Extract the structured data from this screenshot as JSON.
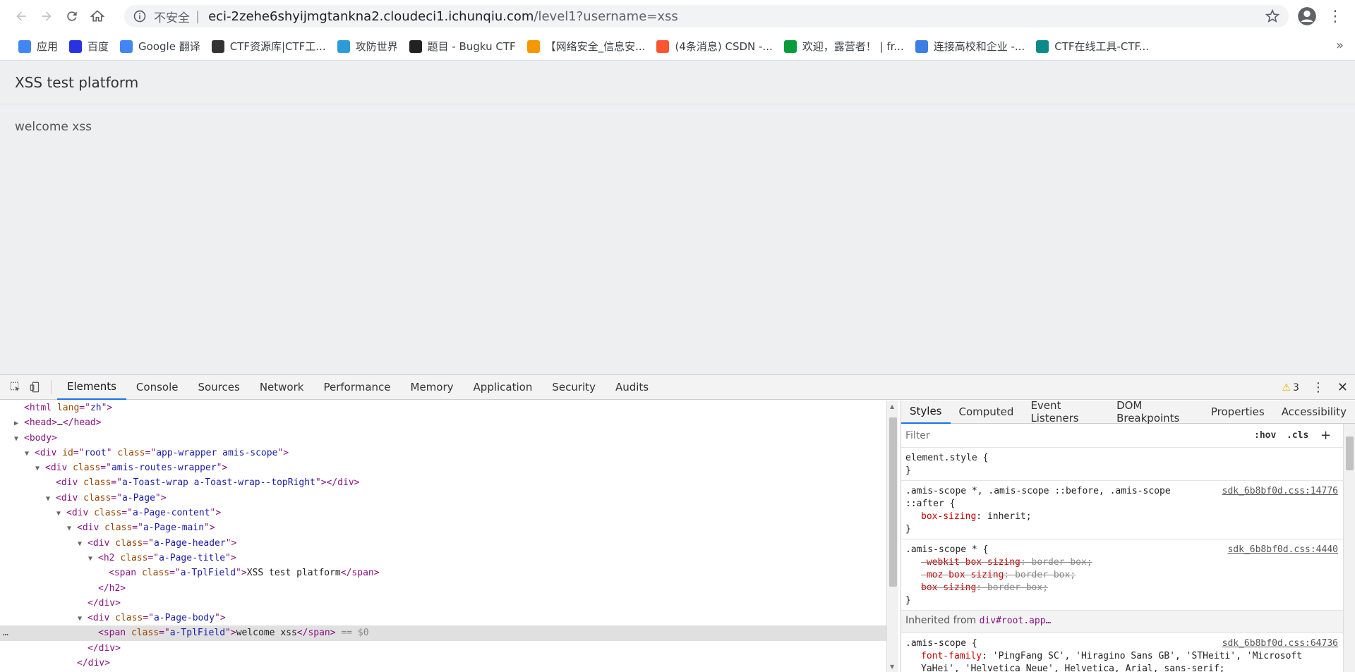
{
  "browser": {
    "security_label": "不安全",
    "separator": "|",
    "url_host": "eci-2zehe6shyijmgtankna2.cloudeci1.ichunqiu.com",
    "url_path": "/level1?username=xss",
    "more_bookmarks": "»",
    "bookmarks": [
      {
        "label": "应用",
        "icon": "apps-grid-icon",
        "color": "#4285f4"
      },
      {
        "label": "百度",
        "icon": "baidu-paw-icon",
        "color": "#2932e1"
      },
      {
        "label": "Google 翻译",
        "icon": "google-translate-icon",
        "color": "#4285f4"
      },
      {
        "label": "CTF资源库|CTF工...",
        "icon": "ctf-hacker-icon",
        "color": "#333333"
      },
      {
        "label": "攻防世界",
        "icon": "swirl-icon",
        "color": "#2e9bd8"
      },
      {
        "label": "题目 - Bugku CTF",
        "icon": "flag-icon",
        "color": "#222222"
      },
      {
        "label": "【网络安全_信息安...",
        "icon": "hexagon-icon",
        "color": "#f39800"
      },
      {
        "label": "(4条消息) CSDN -...",
        "icon": "csdn-c-icon",
        "color": "#fc5531"
      },
      {
        "label": "欢迎，露营者！ | fr...",
        "icon": "freecodecamp-icon",
        "color": "#0a9b3c"
      },
      {
        "label": "连接高校和企业 -...",
        "icon": "cloud-link-icon",
        "color": "#3d7ee5"
      },
      {
        "label": "CTF在线工具-CTF...",
        "icon": "ctf-tools-icon",
        "color": "#0b8a8a"
      }
    ]
  },
  "page": {
    "title": "XSS test platform",
    "body_text": "welcome xss"
  },
  "devtools": {
    "tabs": [
      "Elements",
      "Console",
      "Sources",
      "Network",
      "Performance",
      "Memory",
      "Application",
      "Security",
      "Audits"
    ],
    "warning_count": "3",
    "elements_lines": [
      {
        "indent": 0,
        "toggle": "",
        "parts": [
          [
            "tag",
            "<html "
          ],
          [
            "attr",
            "lang"
          ],
          [
            "tag",
            "=\""
          ],
          [
            "val",
            "zh"
          ],
          [
            "tag",
            "\">"
          ]
        ]
      },
      {
        "indent": 0,
        "toggle": "▶",
        "parts": [
          [
            "tag",
            "<head>"
          ],
          [
            "txt",
            "…"
          ],
          [
            "tag",
            "</head>"
          ]
        ]
      },
      {
        "indent": 0,
        "toggle": "▼",
        "parts": [
          [
            "tag",
            "<body>"
          ]
        ]
      },
      {
        "indent": 1,
        "toggle": "▼",
        "parts": [
          [
            "tag",
            "<div "
          ],
          [
            "attr",
            "id"
          ],
          [
            "tag",
            "=\""
          ],
          [
            "val",
            "root"
          ],
          [
            "tag",
            "\" "
          ],
          [
            "attr",
            "class"
          ],
          [
            "tag",
            "=\""
          ],
          [
            "val",
            "app-wrapper amis-scope"
          ],
          [
            "tag",
            "\">"
          ]
        ]
      },
      {
        "indent": 2,
        "toggle": "▼",
        "parts": [
          [
            "tag",
            "<div "
          ],
          [
            "attr",
            "class"
          ],
          [
            "tag",
            "=\""
          ],
          [
            "val",
            "amis-routes-wrapper"
          ],
          [
            "tag",
            "\">"
          ]
        ]
      },
      {
        "indent": 3,
        "toggle": "",
        "parts": [
          [
            "tag",
            "<div "
          ],
          [
            "attr",
            "class"
          ],
          [
            "tag",
            "=\""
          ],
          [
            "val",
            "a-Toast-wrap a-Toast-wrap--topRight"
          ],
          [
            "tag",
            "\"></div>"
          ]
        ]
      },
      {
        "indent": 3,
        "toggle": "▼",
        "parts": [
          [
            "tag",
            "<div "
          ],
          [
            "attr",
            "class"
          ],
          [
            "tag",
            "=\""
          ],
          [
            "val",
            "a-Page"
          ],
          [
            "tag",
            "\">"
          ]
        ]
      },
      {
        "indent": 4,
        "toggle": "▼",
        "parts": [
          [
            "tag",
            "<div "
          ],
          [
            "attr",
            "class"
          ],
          [
            "tag",
            "=\""
          ],
          [
            "val",
            "a-Page-content"
          ],
          [
            "tag",
            "\">"
          ]
        ]
      },
      {
        "indent": 5,
        "toggle": "▼",
        "parts": [
          [
            "tag",
            "<div "
          ],
          [
            "attr",
            "class"
          ],
          [
            "tag",
            "=\""
          ],
          [
            "val",
            "a-Page-main"
          ],
          [
            "tag",
            "\">"
          ]
        ]
      },
      {
        "indent": 6,
        "toggle": "▼",
        "parts": [
          [
            "tag",
            "<div "
          ],
          [
            "attr",
            "class"
          ],
          [
            "tag",
            "=\""
          ],
          [
            "val",
            "a-Page-header"
          ],
          [
            "tag",
            "\">"
          ]
        ]
      },
      {
        "indent": 7,
        "toggle": "▼",
        "parts": [
          [
            "tag",
            "<h2 "
          ],
          [
            "attr",
            "class"
          ],
          [
            "tag",
            "=\""
          ],
          [
            "val",
            "a-Page-title"
          ],
          [
            "tag",
            "\">"
          ]
        ]
      },
      {
        "indent": 8,
        "toggle": "",
        "parts": [
          [
            "tag",
            "<span "
          ],
          [
            "attr",
            "class"
          ],
          [
            "tag",
            "=\""
          ],
          [
            "val",
            "a-TplField"
          ],
          [
            "tag",
            "\">"
          ],
          [
            "txt",
            "XSS test platform"
          ],
          [
            "tag",
            "</span>"
          ]
        ]
      },
      {
        "indent": 7,
        "toggle": "",
        "parts": [
          [
            "tag",
            "</h2>"
          ]
        ]
      },
      {
        "indent": 6,
        "toggle": "",
        "parts": [
          [
            "tag",
            "</div>"
          ]
        ]
      },
      {
        "indent": 6,
        "toggle": "▼",
        "parts": [
          [
            "tag",
            "<div "
          ],
          [
            "attr",
            "class"
          ],
          [
            "tag",
            "=\""
          ],
          [
            "val",
            "a-Page-body"
          ],
          [
            "tag",
            "\">"
          ]
        ]
      },
      {
        "indent": 7,
        "toggle": "",
        "selected": true,
        "parts": [
          [
            "tag",
            "<span "
          ],
          [
            "attr",
            "class"
          ],
          [
            "tag",
            "=\""
          ],
          [
            "val",
            "a-TplField"
          ],
          [
            "tag",
            "\">"
          ],
          [
            "txt",
            "welcome xss"
          ],
          [
            "tag",
            "</span>"
          ],
          [
            "eq",
            " == $0"
          ]
        ]
      },
      {
        "indent": 6,
        "toggle": "",
        "parts": [
          [
            "tag",
            "</div>"
          ]
        ]
      },
      {
        "indent": 5,
        "toggle": "",
        "parts": [
          [
            "tag",
            "</div>"
          ]
        ]
      }
    ],
    "styles_tabs": [
      "Styles",
      "Computed",
      "Event Listeners",
      "DOM Breakpoints",
      "Properties",
      "Accessibility"
    ],
    "filter_placeholder": "Filter",
    "hov": ":hov",
    "cls": ".cls",
    "plus": "+",
    "rules": [
      {
        "selector": "element.style {",
        "source": "",
        "props": [],
        "close": "}"
      },
      {
        "selector": ".amis-scope *, .amis-scope ::before, .amis-scope ::after {",
        "source": "sdk_6b8bf0d.css:14776",
        "props": [
          {
            "name": "box-sizing",
            "value": "inherit;",
            "struck": false
          }
        ],
        "close": "}"
      },
      {
        "selector": ".amis-scope * {",
        "source": "sdk_6b8bf0d.css:4440",
        "props": [
          {
            "name": "-webkit-box-sizing",
            "value": "border-box;",
            "struck": true
          },
          {
            "name": "-moz-box-sizing",
            "value": "border-box;",
            "struck": true
          },
          {
            "name": "box-sizing",
            "value": "border-box;",
            "struck": true
          }
        ],
        "close": "}"
      }
    ],
    "inherited_label": "Inherited from",
    "inherited_el": "div#root.app…",
    "last_rule": {
      "selector": ".amis-scope {",
      "source": "sdk_6b8bf0d.css:64736",
      "prop_name": "font-family",
      "prop_value": "'PingFang SC', 'Hiragino Sans GB', 'STHeiti', 'Microsoft YaHei', 'Helvetica Neue', Helvetica, Arial, sans-serif;"
    }
  }
}
